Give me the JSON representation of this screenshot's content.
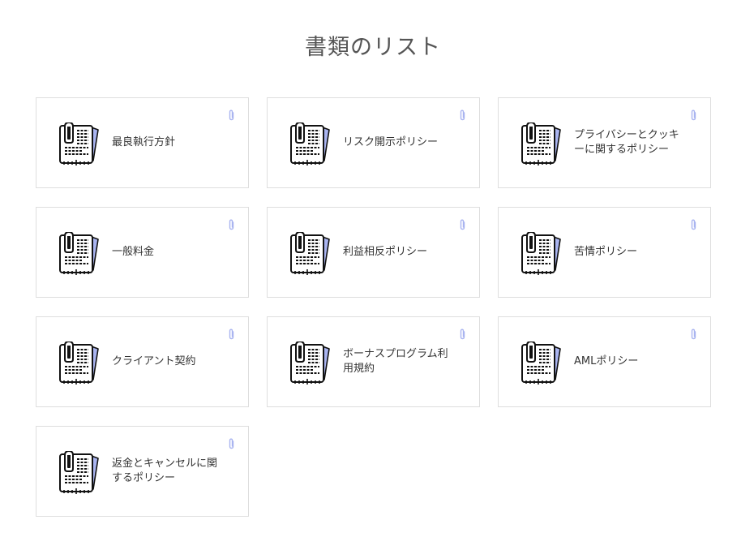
{
  "page": {
    "title": "書類のリスト"
  },
  "colors": {
    "card_border": "#dedede",
    "icon_accent": "#a9b4f0",
    "text": "#333333"
  },
  "documents": [
    {
      "label": "最良執行方針",
      "icon": "document-icon",
      "attachment_icon": "paperclip-icon"
    },
    {
      "label": "リスク開示ポリシー",
      "icon": "document-icon",
      "attachment_icon": "paperclip-icon"
    },
    {
      "label": "プライバシーとクッキーに関するポリシー",
      "icon": "document-icon",
      "attachment_icon": "paperclip-icon"
    },
    {
      "label": "一般料金",
      "icon": "document-icon",
      "attachment_icon": "paperclip-icon"
    },
    {
      "label": "利益相反ポリシー",
      "icon": "document-icon",
      "attachment_icon": "paperclip-icon"
    },
    {
      "label": "苦情ポリシー",
      "icon": "document-icon",
      "attachment_icon": "paperclip-icon"
    },
    {
      "label": "クライアント契約",
      "icon": "document-icon",
      "attachment_icon": "paperclip-icon"
    },
    {
      "label": "ボーナスプログラム利用規約",
      "icon": "document-icon",
      "attachment_icon": "paperclip-icon"
    },
    {
      "label": "AMLポリシー",
      "icon": "document-icon",
      "attachment_icon": "paperclip-icon"
    },
    {
      "label": "返金とキャンセルに関するポリシー",
      "icon": "document-icon",
      "attachment_icon": "paperclip-icon"
    }
  ]
}
